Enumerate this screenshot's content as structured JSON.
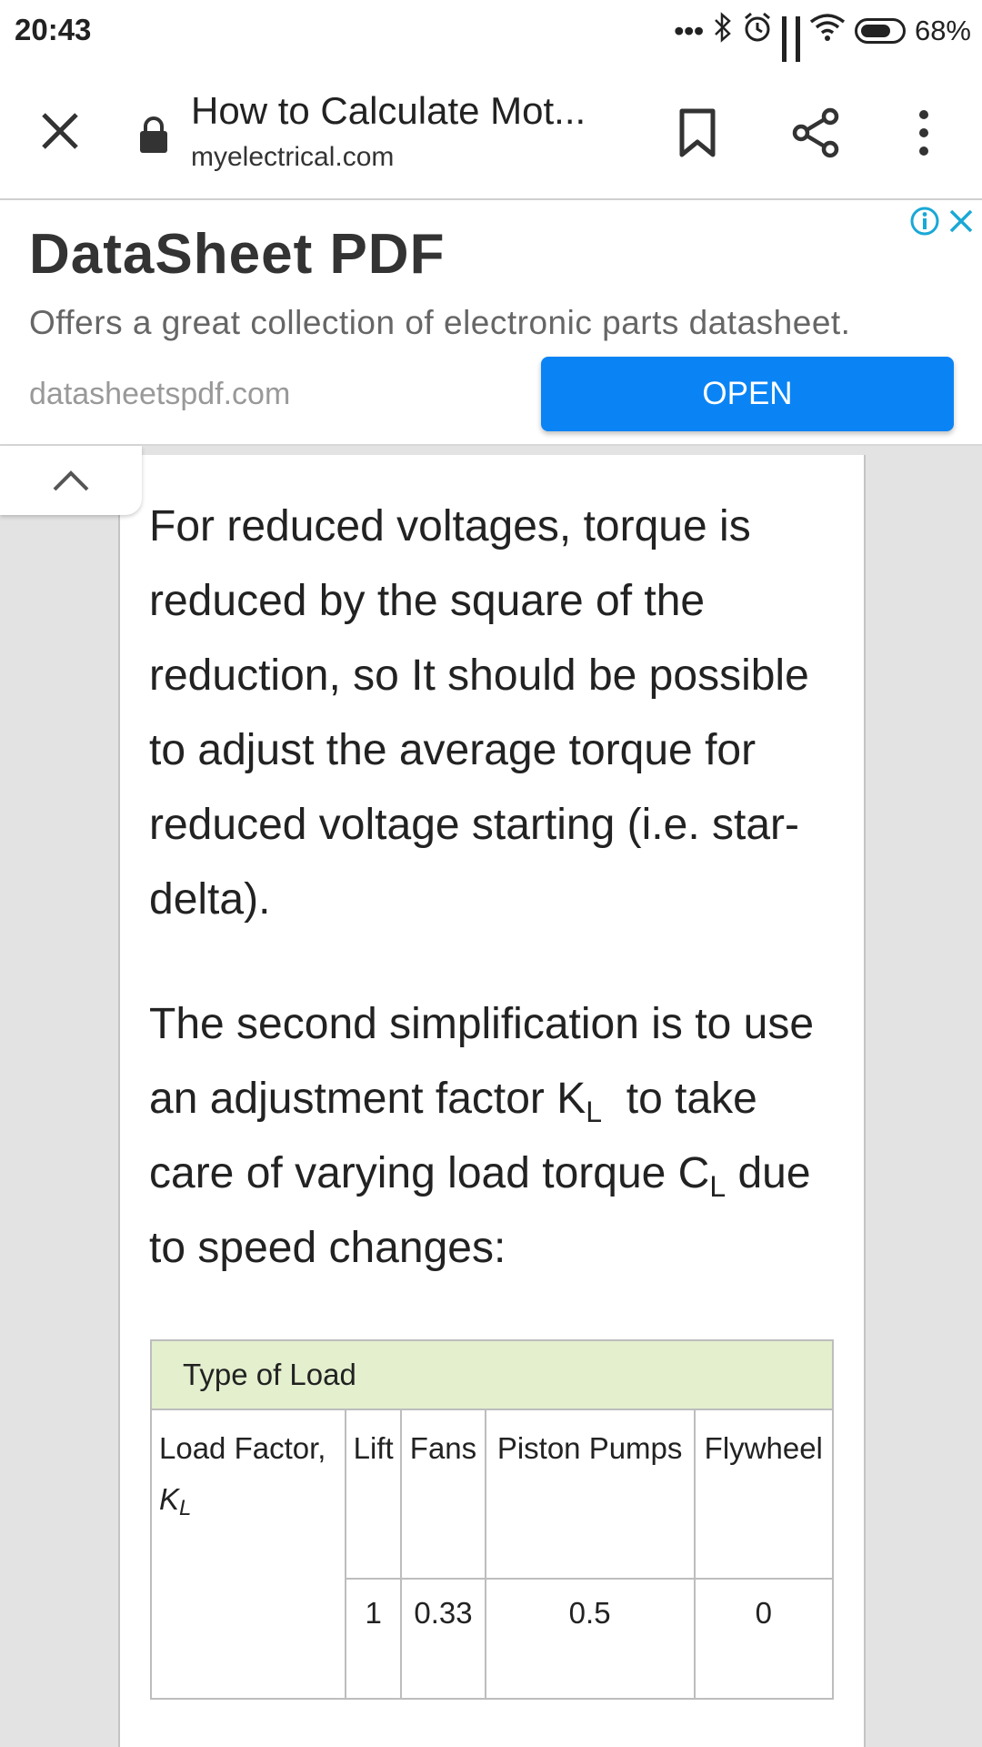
{
  "status_bar": {
    "time": "20:43",
    "dots": "•••",
    "battery_percent": "68%"
  },
  "browser": {
    "page_title": "How to Calculate Mot...",
    "domain": "myelectrical.com",
    "icons": [
      "close-icon",
      "lock-icon",
      "bookmark-icon",
      "share-icon",
      "more-vert-icon"
    ]
  },
  "ad": {
    "title": "DataSheet PDF",
    "description": "Offers a great collection of electronic parts datasheet.",
    "domain": "datasheetspdf.com",
    "open_label": "OPEN",
    "accent_color": "#0a84f5"
  },
  "article": {
    "paragraph1": "For reduced voltages, torque is reduced by the square of the reduction, so It should be possible to adjust the average torque for reduced voltage starting (i.e. star-delta).",
    "paragraph2_part1": "The second simplification is to use an adjustment factor K",
    "paragraph2_sub1": "L",
    "paragraph2_part2": "  to take care of varying load torque C",
    "paragraph2_sub2": "L",
    "paragraph2_part3": " due to speed changes:"
  },
  "load_table": {
    "header": "Type of Load",
    "row_label": "Load Factor,",
    "row_label_symbol": "K",
    "row_label_sub": "L",
    "columns": [
      "Lift",
      "Fans",
      "Piston Pumps",
      "Flywheel"
    ],
    "values": [
      "1",
      "0.33",
      "0.5",
      "0"
    ],
    "header_color": "#e3efcd"
  }
}
